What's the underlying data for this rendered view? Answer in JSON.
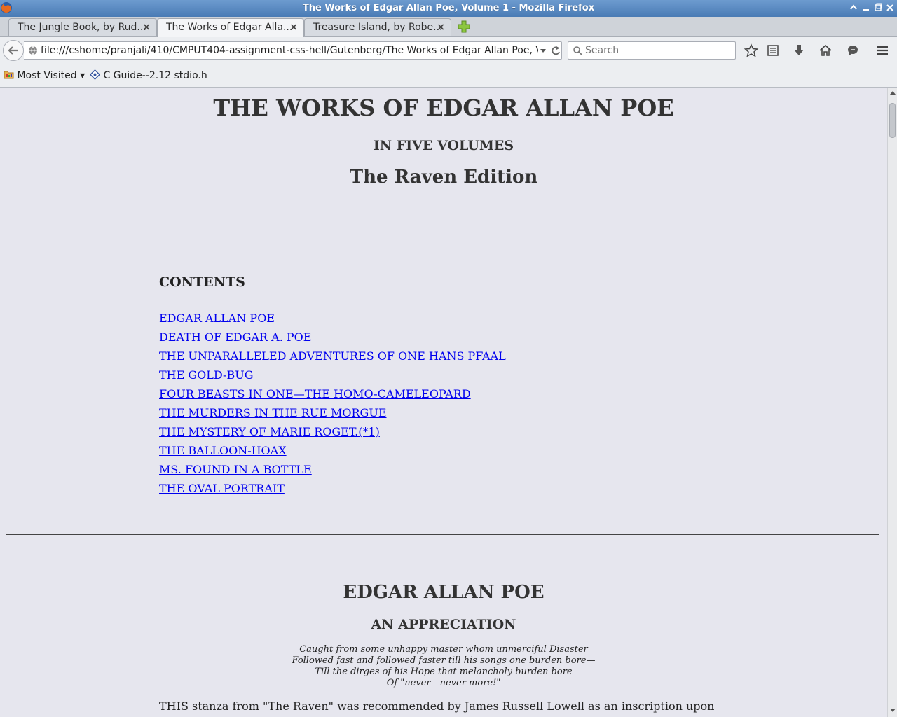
{
  "window": {
    "title": "The Works of Edgar Allan Poe, Volume 1 - Mozilla Firefox"
  },
  "tabs": [
    {
      "label": "The Jungle Book, by Rud...",
      "active": false
    },
    {
      "label": "The Works of Edgar Alla...",
      "active": true
    },
    {
      "label": "Treasure Island, by Robe...",
      "active": false
    }
  ],
  "tab_close_glyph": "×",
  "navbar": {
    "url": "file:///cshome/pranjali/410/CMPUT404-assignment-css-hell/Gutenberg/The Works of Edgar Allan Poe, Volume",
    "search_placeholder": "Search"
  },
  "bookmarks": [
    {
      "label": "Most Visited ▾",
      "icon": "folder-icon"
    },
    {
      "label": "C Guide--2.12 stdio.h",
      "icon": "bookmark-page-icon"
    }
  ],
  "page": {
    "title": "THE WORKS OF EDGAR ALLAN POE",
    "subtitle": "IN FIVE VOLUMES",
    "edition": "The Raven Edition",
    "contents_heading": "CONTENTS",
    "contents": [
      "EDGAR ALLAN POE",
      "DEATH OF EDGAR A. POE",
      "THE UNPARALLELED ADVENTURES OF ONE HANS PFAAL",
      "THE GOLD-BUG",
      "FOUR BEASTS IN ONE—THE HOMO-CAMELEOPARD",
      "THE MURDERS IN THE RUE MORGUE",
      "THE MYSTERY OF MARIE ROGET.(*1)",
      "THE BALLOON-HOAX",
      "MS. FOUND IN A BOTTLE",
      "THE OVAL PORTRAIT"
    ],
    "section_title": "EDGAR ALLAN POE",
    "section_subtitle": "AN APPRECIATION",
    "poem": [
      "Caught from some unhappy master whom unmerciful Disaster",
      "Followed fast and followed faster till his songs one burden bore—",
      "Till the dirges of his Hope that melancholy burden bore",
      "Of \"never—never more!\""
    ],
    "paragraph": "THIS stanza from \"The Raven\" was recommended by James Russell Lowell as an inscription upon the Baltimore monument which marks the resting place of Edgar Allan Poe, the most interesting and original figure in American letters."
  },
  "colors": {
    "link": "#0000ee",
    "page_background": "#e6e6ee",
    "titlebar": "#5585c0"
  }
}
